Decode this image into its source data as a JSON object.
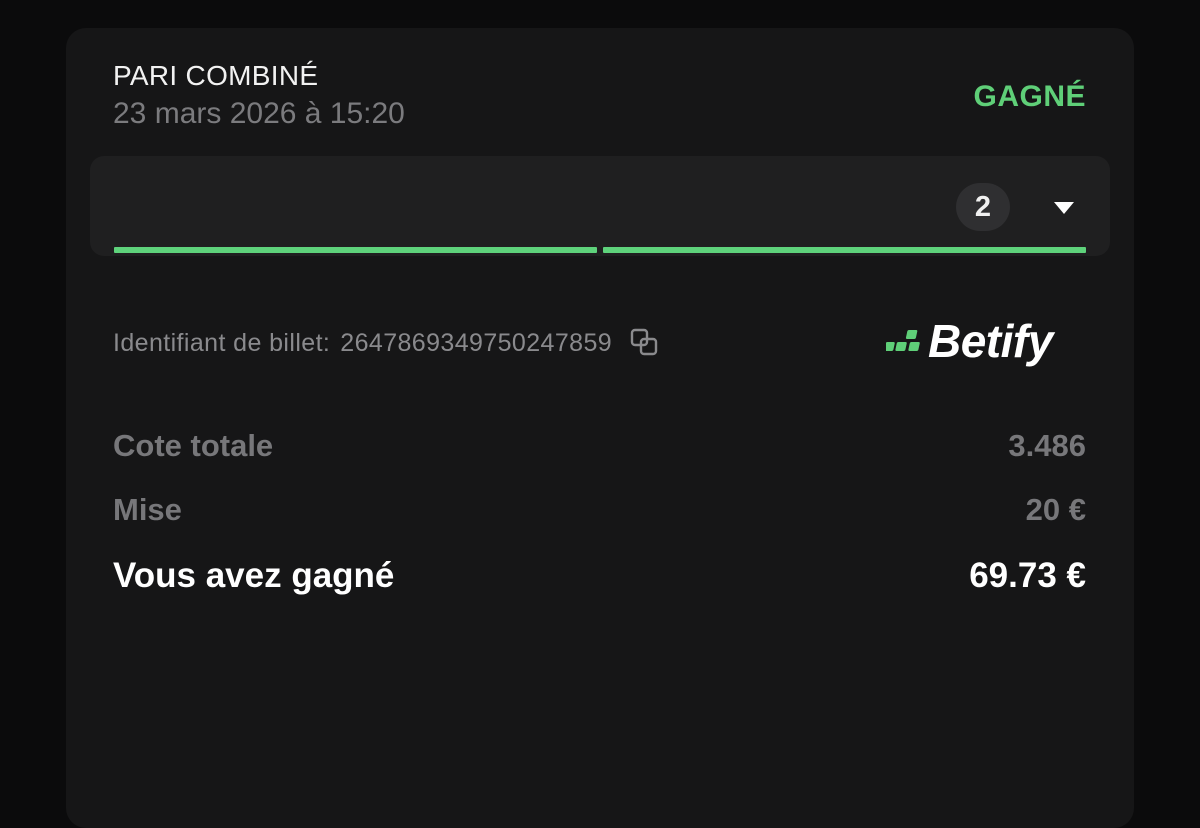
{
  "bet": {
    "type": "PARI COMBINÉ",
    "date": "23 mars 2026 à 15:20",
    "status": "GAGNÉ",
    "legs_count": "2",
    "legs_progress": [
      1,
      1
    ]
  },
  "ticket": {
    "label": "Identifiant de billet:",
    "id": "2647869349750247859"
  },
  "brand": {
    "name": "Betify",
    "accent_color": "#5fcf78"
  },
  "summary": {
    "odds_label": "Cote totale",
    "odds_value": "3.486",
    "stake_label": "Mise",
    "stake_value": "20 €",
    "win_label": "Vous avez gagné",
    "win_value": "69.73 €"
  },
  "icons": {
    "expand": "caret-down-icon",
    "copy": "copy-icon"
  }
}
